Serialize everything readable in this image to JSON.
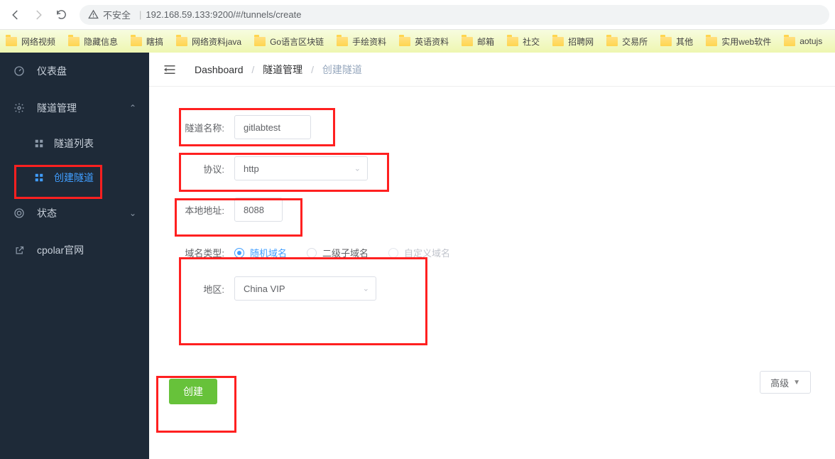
{
  "browser": {
    "security_label": "不安全",
    "url": "192.168.59.133:9200/#/tunnels/create"
  },
  "bookmarks": [
    "网络视频",
    "隐藏信息",
    "瞎搞",
    "网络资料java",
    "Go语言区块链",
    "手绘资料",
    "英语资料",
    "邮箱",
    "社交",
    "招聘网",
    "交易所",
    "其他",
    "实用web软件",
    "aotujs"
  ],
  "sidebar": {
    "dashboard": "仪表盘",
    "tunnel_mgmt": "隧道管理",
    "tunnel_list": "隧道列表",
    "tunnel_create": "创建隧道",
    "status": "状态",
    "cpolar": "cpolar官网"
  },
  "breadcrumb": {
    "dashboard": "Dashboard",
    "tunnel_mgmt": "隧道管理",
    "create": "创建隧道"
  },
  "form": {
    "name_label": "隧道名称:",
    "name_value": "gitlabtest",
    "proto_label": "协议:",
    "proto_value": "http",
    "addr_label": "本地地址:",
    "addr_value": "8088",
    "domain_type_label": "域名类型:",
    "domain_random": "随机域名",
    "domain_sub": "二级子域名",
    "domain_custom": "自定义域名",
    "region_label": "地区:",
    "region_value": "China VIP",
    "advanced": "高级",
    "create_btn": "创建"
  }
}
